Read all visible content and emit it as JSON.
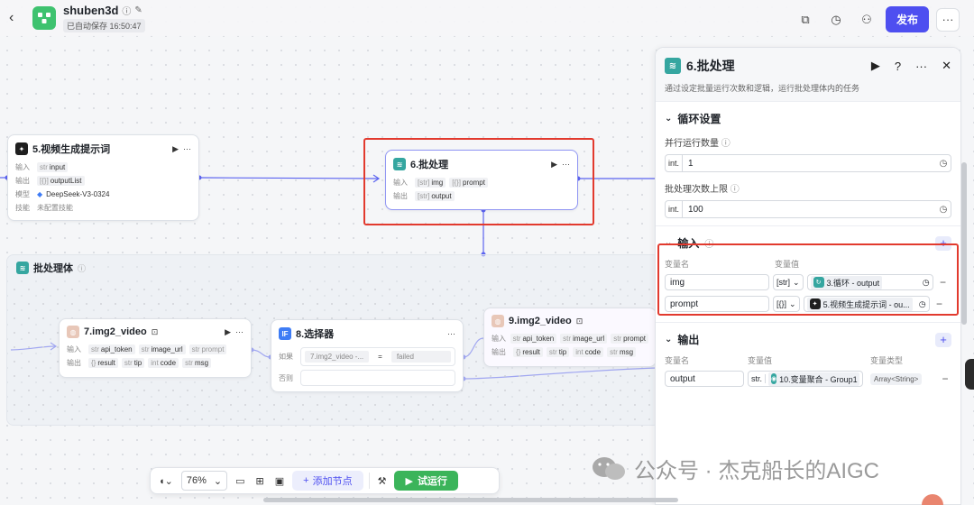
{
  "header": {
    "app_name": "shuben3d",
    "autosave": "已自动保存 16:50:47",
    "publish_label": "发布"
  },
  "nodes": {
    "prompt_gen": {
      "title": "5.视频生成提示词",
      "input_label": "输入",
      "input_type": "str",
      "input_name": "input",
      "output_label": "输出",
      "output_type": "[{}]",
      "output_name": "outputList",
      "model_label": "模型",
      "model_value": "DeepSeek-V3-0324",
      "skill_label": "技能",
      "skill_value": "未配置技能"
    },
    "batch": {
      "title": "6.批处理",
      "input_label": "输入",
      "in1_type": "[str]",
      "in1_name": "img",
      "in2_type": "[{}]",
      "in2_name": "prompt",
      "output_label": "输出",
      "out_type": "[str]",
      "out_name": "output"
    },
    "frame_title": "批处理体",
    "img2video_7": {
      "title": "7.img2_video",
      "input_label": "输入",
      "in1_type": "str",
      "in1_name": "api_token",
      "in2_type": "str",
      "in2_name": "image_url",
      "in3_type": "str",
      "in3_name": "prompt",
      "output_label": "输出",
      "out1_type": "{}",
      "out1_name": "result",
      "out2_type": "str",
      "out2_name": "tip",
      "out3_type": "int",
      "out3_name": "code",
      "out4_type": "str",
      "out4_name": "msg"
    },
    "selector": {
      "title": "8.选择器",
      "if_label": "如果",
      "field": "7.img2_video -...",
      "op": "=",
      "value": "failed",
      "else_label": "否则"
    },
    "img2video_9": {
      "title": "9.img2_video",
      "input_label": "输入",
      "in1_type": "str",
      "in1_name": "api_token",
      "in2_type": "str",
      "in2_name": "image_url",
      "in3_type": "str",
      "in3_name": "prompt",
      "output_label": "输出",
      "out1_type": "{}",
      "out1_name": "result",
      "out2_type": "str",
      "out2_name": "tip",
      "out3_type": "int",
      "out3_name": "code",
      "out4_type": "str",
      "out4_name": "msg"
    }
  },
  "panel": {
    "title": "6.批处理",
    "description": "通过设定批量运行次数和逻辑，运行批处理体内的任务",
    "loop_section": "循环设置",
    "parallel_label": "并行运行数量",
    "parallel_type": "int.",
    "parallel_value": "1",
    "max_label": "批处理次数上限",
    "max_type": "int.",
    "max_value": "100",
    "input_section": "输入",
    "col_name": "变量名",
    "col_value": "变量值",
    "col_type": "变量类型",
    "inputs": [
      {
        "name": "img",
        "type": "[str]",
        "ref": "3.循环 - output"
      },
      {
        "name": "prompt",
        "type": "[{}]",
        "ref": "5.视频生成提示词 - ou..."
      }
    ],
    "output_section": "输出",
    "outputs": [
      {
        "name": "output",
        "type": "str.",
        "ref": "10.变量聚合 - Group1",
        "var_type": "Array<String>"
      }
    ]
  },
  "toolbar": {
    "zoom": "76%",
    "add_node": "添加节点",
    "run": "试运行"
  },
  "watermark": "公众号 · 杰克船长的AIGC"
}
